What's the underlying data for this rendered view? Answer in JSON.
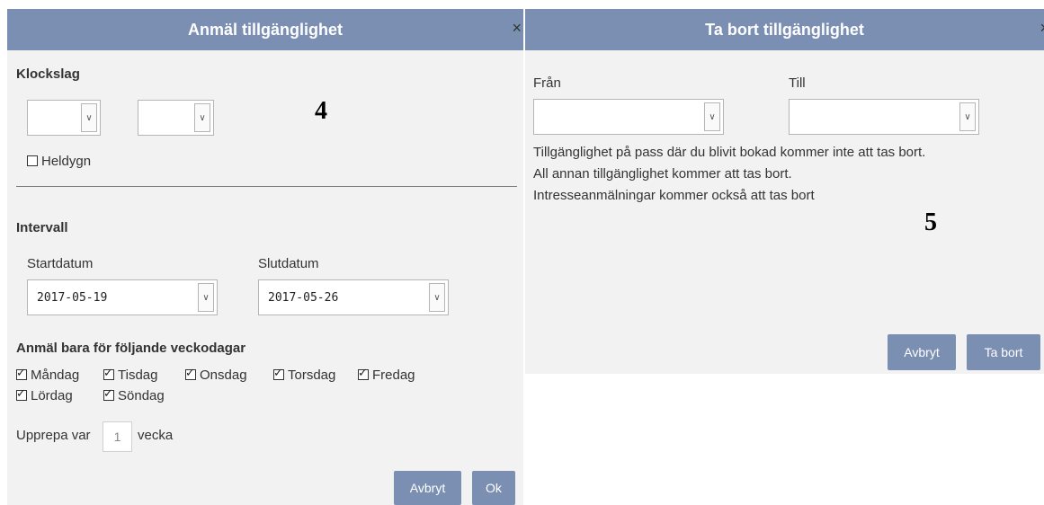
{
  "dialog_left": {
    "title": "Anmäl tillgänglighet",
    "close": "×",
    "klockslag_label": "Klockslag",
    "heldygn_label": "Heldygn",
    "intervall_label": "Intervall",
    "startdatum_label": "Startdatum",
    "startdatum_value": "2017-05-19",
    "slutdatum_label": "Slutdatum",
    "slutdatum_value": "2017-05-26",
    "weekdays_label": "Anmäl bara för följande veckodagar",
    "days": [
      "Måndag",
      "Tisdag",
      "Onsdag",
      "Torsdag",
      "Fredag",
      "Lördag",
      "Söndag"
    ],
    "repeat_prefix": "Upprepa var",
    "repeat_value": "1",
    "repeat_suffix": "vecka",
    "cancel_label": "Avbryt",
    "ok_label": "Ok",
    "annotation": "4"
  },
  "dialog_right": {
    "title": "Ta bort tillgänglighet",
    "close": "×",
    "from_label": "Från",
    "to_label": "Till",
    "msg1": "Tillgänglighet på pass där du blivit bokad kommer inte att tas bort.",
    "msg2": "All annan tillgänglighet kommer att tas bort.",
    "msg3": "Intresseanmälningar kommer också att tas bort",
    "cancel_label": "Avbryt",
    "delete_label": "Ta bort",
    "annotation": "5"
  },
  "icons": {
    "dropdown": "chevron-down-icon",
    "check": "check-icon",
    "close": "close-icon"
  },
  "colors": {
    "titlebar": "#7b8fb3",
    "button": "#7b8fb3",
    "panel": "#f2f2f2"
  }
}
